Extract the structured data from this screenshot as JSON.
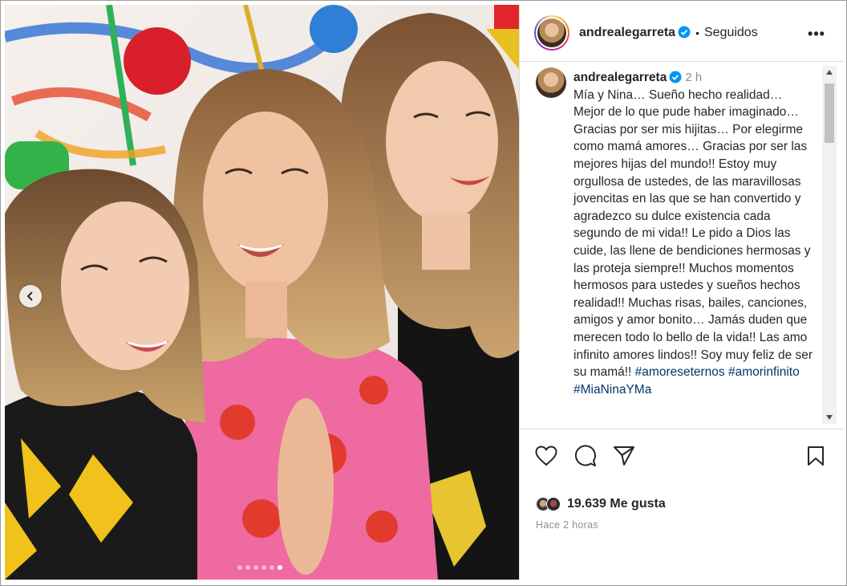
{
  "post": {
    "username": "andrealegarreta",
    "separator": "•",
    "follow_status": "Seguidos",
    "more_label": "•••"
  },
  "caption": {
    "username": "andrealegarreta",
    "time": "2 h",
    "text": "Mía y Nina… Sueño hecho realidad… Mejor de lo que pude haber imaginado… Gracias por ser mis hijitas… Por elegirme como mamá amores… Gracias por ser las mejores hijas del mundo!! Estoy muy orgullosa de ustedes, de las maravillosas jovencitas en las que se han convertido y agradezco su dulce existencia cada segundo de mi vida!! Le pido a Dios las cuide, las llene de bendiciones hermosas y las proteja siempre!! Muchos momentos hermosos para ustedes y sueños hechos realidad!! Muchas risas, bailes, canciones, amigos y amor bonito… Jamás duden que merecen todo lo bello de la vida!! Las amo infinito amores lindos!! Soy muy feliz de ser su mamá!! ",
    "hashtags": [
      "#amoreseternos",
      "#amorinfinito",
      "#MiaNinaYMa"
    ]
  },
  "engagement": {
    "likes": "19.639 Me gusta",
    "posted": "Hace 2 horas"
  },
  "carousel": {
    "total_slides": 6,
    "active_index": 5
  },
  "colors": {
    "accent_blue": "#0095f6",
    "hashtag": "#00376b",
    "muted": "#8e8e8e",
    "border": "#dbdbdb"
  },
  "icons": {
    "like": "heart-icon",
    "comment": "comment-icon",
    "share": "send-icon",
    "save": "bookmark-icon",
    "verified": "verified-badge-icon",
    "more": "more-options-icon",
    "prev": "chevron-left-icon"
  }
}
